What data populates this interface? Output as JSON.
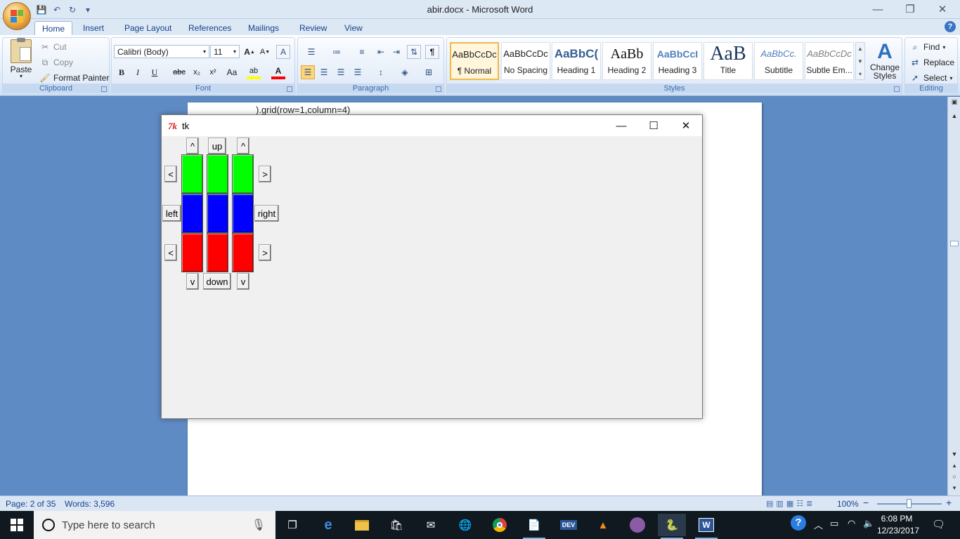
{
  "window": {
    "title": "abir.docx - Microsoft Word",
    "controls": {
      "minimize": "—",
      "restore": "❐",
      "close": "✕"
    }
  },
  "qat": {
    "save": "💾",
    "undo": "↶",
    "redo": "↻",
    "customize": "▾"
  },
  "ribbon": {
    "tabs": [
      "Home",
      "Insert",
      "Page Layout",
      "References",
      "Mailings",
      "Review",
      "View"
    ],
    "active_tab": "Home",
    "help": "?",
    "clipboard": {
      "label": "Clipboard",
      "paste": "Paste",
      "cut": "Cut",
      "copy": "Copy",
      "format_painter": "Format Painter"
    },
    "font": {
      "label": "Font",
      "family": "Calibri (Body)",
      "size": "11",
      "grow": "A",
      "shrink": "A",
      "clear": "A",
      "bold": "B",
      "italic": "I",
      "underline": "U",
      "strike": "abc",
      "subscript": "x₂",
      "superscript": "x²",
      "change_case": "Aa",
      "highlight": "ab",
      "font_color": "A"
    },
    "paragraph": {
      "label": "Paragraph",
      "show_marks": "¶"
    },
    "styles": {
      "label": "Styles",
      "items": [
        {
          "sample": "AaBbCcDc",
          "name": "¶ Normal"
        },
        {
          "sample": "AaBbCcDc",
          "name": "No Spacing"
        },
        {
          "sample": "AaBbC(",
          "name": "Heading 1"
        },
        {
          "sample": "AaBb",
          "name": "Heading 2"
        },
        {
          "sample": "AaBbCcI",
          "name": "Heading 3"
        },
        {
          "sample": "AaB",
          "name": "Title"
        },
        {
          "sample": "AaBbCc.",
          "name": "Subtitle"
        },
        {
          "sample": "AaBbCcDc",
          "name": "Subtle Em..."
        }
      ],
      "change_styles_line1": "Change",
      "change_styles_line2": "Styles",
      "change_styles_icon": "A"
    },
    "editing": {
      "label": "Editing",
      "find": "Find",
      "replace": "Replace",
      "select": "Select"
    }
  },
  "document": {
    "visible_line": ").grid(row=1,column=4)"
  },
  "tk": {
    "title": "tk",
    "logo": "7k",
    "controls": {
      "minimize": "—",
      "maximize": "☐",
      "close": "✕"
    },
    "buttons": {
      "up_left": "^",
      "up": "up",
      "up_right": "^",
      "left_top": "<",
      "left": "left",
      "left_bottom": "<",
      "right_top": ">",
      "right": "right",
      "right_bottom": ">",
      "down_left": "v",
      "down": "down",
      "down_right": "v"
    },
    "grid_colors": {
      "row1": "#00ff00",
      "row2": "#0000ff",
      "row3": "#ff0000"
    }
  },
  "status": {
    "page": "Page: 2 of 35",
    "words": "Words: 3,596",
    "zoom": "100%",
    "zoom_minus": "−",
    "zoom_plus": "+"
  },
  "taskbar": {
    "search_placeholder": "Type here to search",
    "time": "6:08 PM",
    "date": "12/23/2017"
  }
}
